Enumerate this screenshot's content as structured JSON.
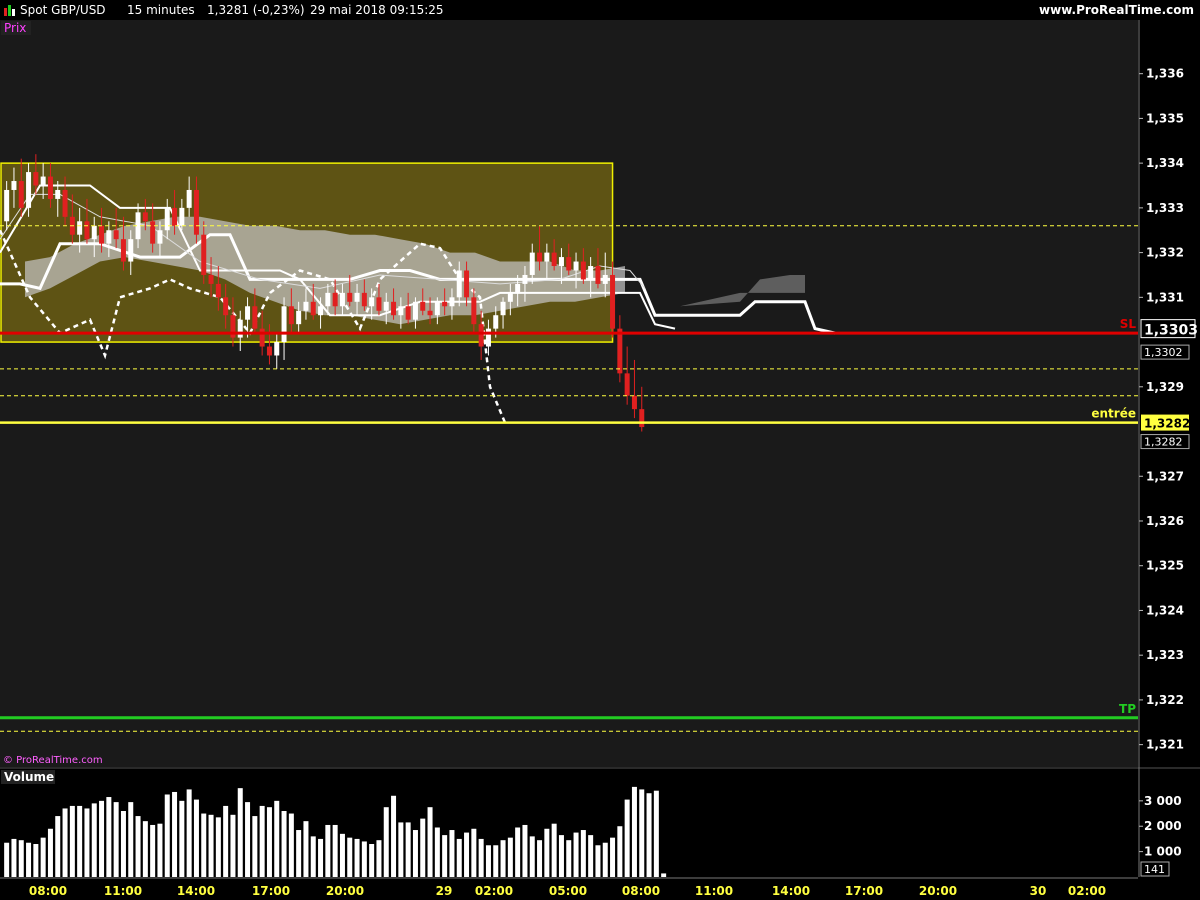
{
  "header": {
    "instrument": "Spot GBP/USD",
    "timeframe": "15 minutes",
    "last_price": "1,3281 (-0,23%)",
    "datetime": "29 mai 2018 09:15:25",
    "website": "www.ProRealTime.com"
  },
  "panels": {
    "price_label": "Prix",
    "volume_label": "Volume",
    "copyright": "© ProRealTime.com"
  },
  "colors": {
    "background": "#000000",
    "panel_bg": "#1a1a1a",
    "grid": "#404040",
    "up_candle": "#ffffff",
    "down_candle": "#e02020",
    "sl_line": "#e00000",
    "tp_line": "#22cc22",
    "entry_line": "#ffff40",
    "zone_fill": "#6b5e14",
    "zone_border": "#f0f000",
    "cloud": "#c8c8c8",
    "axis_text": "#ffffff"
  },
  "chart_data": {
    "type": "candlestick",
    "price_axis": {
      "ylim": [
        1.3205,
        1.3372
      ],
      "ticks": [
        "1,336",
        "1,335",
        "1,334",
        "1,333",
        "1,332",
        "1,331",
        "1,329",
        "1,327",
        "1,326",
        "1,325",
        "1,324",
        "1,323",
        "1,322",
        "1,321"
      ]
    },
    "time_axis": {
      "ticks": [
        "08:00",
        "11:00",
        "14:00",
        "17:00",
        "20:00",
        "29",
        "02:00",
        "05:00",
        "08:00",
        "11:00",
        "14:00",
        "17:00",
        "20:00",
        "30",
        "02:00"
      ]
    },
    "levels": [
      {
        "name": "SL",
        "value": 1.3302,
        "color": "#e00000",
        "label": "SL",
        "tag": "1,3302"
      },
      {
        "name": "entrée",
        "value": 1.3282,
        "color": "#ffff40",
        "label": "entrée",
        "tag": "1,3282"
      },
      {
        "name": "TP",
        "value": 1.3216,
        "color": "#22cc22",
        "label": "TP"
      }
    ],
    "price_tags": [
      {
        "text": "1,3303",
        "value": 1.3303,
        "style": "current"
      },
      {
        "text": "1,3282",
        "value": 1.3282,
        "style": "yellow"
      }
    ],
    "dashed_levels": [
      1.3326,
      1.3294,
      1.3288,
      1.3213
    ],
    "zone": {
      "start_bar": 0,
      "end_bar": 83,
      "top": 1.334,
      "bottom": 1.33
    },
    "candles": [
      [
        1.3327,
        1.3336,
        1.3325,
        1.3334
      ],
      [
        1.3334,
        1.3339,
        1.333,
        1.3336
      ],
      [
        1.3336,
        1.3341,
        1.3328,
        1.333
      ],
      [
        1.333,
        1.334,
        1.3328,
        1.3338
      ],
      [
        1.3338,
        1.3342,
        1.3333,
        1.3335
      ],
      [
        1.3335,
        1.334,
        1.3332,
        1.3337
      ],
      [
        1.3337,
        1.334,
        1.333,
        1.3332
      ],
      [
        1.3332,
        1.3336,
        1.3328,
        1.3334
      ],
      [
        1.3334,
        1.3337,
        1.3326,
        1.3328
      ],
      [
        1.3328,
        1.3333,
        1.3322,
        1.3324
      ],
      [
        1.3324,
        1.333,
        1.332,
        1.3327
      ],
      [
        1.3327,
        1.3332,
        1.3322,
        1.3323
      ],
      [
        1.3323,
        1.3328,
        1.3319,
        1.3326
      ],
      [
        1.3326,
        1.333,
        1.332,
        1.3322
      ],
      [
        1.3322,
        1.3327,
        1.3319,
        1.3325
      ],
      [
        1.3325,
        1.333,
        1.3321,
        1.3323
      ],
      [
        1.3323,
        1.3328,
        1.3316,
        1.3318
      ],
      [
        1.3318,
        1.3325,
        1.3315,
        1.3323
      ],
      [
        1.3323,
        1.3331,
        1.3321,
        1.3329
      ],
      [
        1.3329,
        1.3332,
        1.3325,
        1.3327
      ],
      [
        1.3327,
        1.3331,
        1.332,
        1.3322
      ],
      [
        1.3322,
        1.3327,
        1.3319,
        1.3325
      ],
      [
        1.3325,
        1.3332,
        1.3323,
        1.333
      ],
      [
        1.333,
        1.3334,
        1.3324,
        1.3326
      ],
      [
        1.3326,
        1.3332,
        1.3325,
        1.333
      ],
      [
        1.333,
        1.3337,
        1.3328,
        1.3334
      ],
      [
        1.3334,
        1.3337,
        1.3322,
        1.3324
      ],
      [
        1.3324,
        1.3327,
        1.3313,
        1.3315
      ],
      [
        1.3315,
        1.3319,
        1.331,
        1.3313
      ],
      [
        1.3313,
        1.3317,
        1.3307,
        1.331
      ],
      [
        1.331,
        1.3313,
        1.3303,
        1.3306
      ],
      [
        1.3306,
        1.331,
        1.3299,
        1.3301
      ],
      [
        1.3301,
        1.3307,
        1.3298,
        1.3305
      ],
      [
        1.3305,
        1.331,
        1.3301,
        1.3308
      ],
      [
        1.3308,
        1.3312,
        1.3302,
        1.3303
      ],
      [
        1.3303,
        1.3307,
        1.3297,
        1.3299
      ],
      [
        1.3299,
        1.3304,
        1.3295,
        1.3297
      ],
      [
        1.3297,
        1.3302,
        1.3294,
        1.33
      ],
      [
        1.33,
        1.331,
        1.3296,
        1.3308
      ],
      [
        1.3308,
        1.3312,
        1.3302,
        1.3304
      ],
      [
        1.3304,
        1.3309,
        1.3302,
        1.3307
      ],
      [
        1.3307,
        1.3312,
        1.3305,
        1.3309
      ],
      [
        1.3309,
        1.3313,
        1.3305,
        1.3306
      ],
      [
        1.3306,
        1.331,
        1.3303,
        1.3308
      ],
      [
        1.3308,
        1.3313,
        1.3306,
        1.3311
      ],
      [
        1.3311,
        1.3314,
        1.3306,
        1.3308
      ],
      [
        1.3308,
        1.3313,
        1.3306,
        1.3311
      ],
      [
        1.3311,
        1.3315,
        1.3308,
        1.3309
      ],
      [
        1.3309,
        1.3313,
        1.3306,
        1.3311
      ],
      [
        1.3311,
        1.3314,
        1.3307,
        1.3308
      ],
      [
        1.3308,
        1.3312,
        1.3305,
        1.331
      ],
      [
        1.331,
        1.3313,
        1.3306,
        1.3307
      ],
      [
        1.3307,
        1.3311,
        1.3304,
        1.3309
      ],
      [
        1.3309,
        1.3312,
        1.3305,
        1.3306
      ],
      [
        1.3306,
        1.331,
        1.3303,
        1.3308
      ],
      [
        1.3308,
        1.3311,
        1.3304,
        1.3305
      ],
      [
        1.3305,
        1.331,
        1.3303,
        1.3309
      ],
      [
        1.3309,
        1.3312,
        1.3306,
        1.3307
      ],
      [
        1.3307,
        1.331,
        1.3304,
        1.3306
      ],
      [
        1.3306,
        1.331,
        1.3304,
        1.3309
      ],
      [
        1.3309,
        1.3312,
        1.3306,
        1.3308
      ],
      [
        1.3308,
        1.3312,
        1.3305,
        1.331
      ],
      [
        1.331,
        1.3318,
        1.3308,
        1.3316
      ],
      [
        1.3316,
        1.3318,
        1.3308,
        1.331
      ],
      [
        1.331,
        1.3312,
        1.3302,
        1.3304
      ],
      [
        1.3304,
        1.3307,
        1.3296,
        1.3299
      ],
      [
        1.3299,
        1.3305,
        1.3297,
        1.3303
      ],
      [
        1.3303,
        1.3308,
        1.3301,
        1.3306
      ],
      [
        1.3306,
        1.331,
        1.3303,
        1.3309
      ],
      [
        1.3309,
        1.3313,
        1.3306,
        1.3311
      ],
      [
        1.3311,
        1.3315,
        1.3308,
        1.3313
      ],
      [
        1.3313,
        1.3317,
        1.3309,
        1.3315
      ],
      [
        1.3315,
        1.3322,
        1.3313,
        1.332
      ],
      [
        1.332,
        1.3326,
        1.3316,
        1.3318
      ],
      [
        1.3318,
        1.3322,
        1.3314,
        1.332
      ],
      [
        1.332,
        1.3323,
        1.3316,
        1.3317
      ],
      [
        1.3317,
        1.3321,
        1.3313,
        1.3319
      ],
      [
        1.3319,
        1.3322,
        1.3315,
        1.3316
      ],
      [
        1.3316,
        1.332,
        1.3312,
        1.3318
      ],
      [
        1.3318,
        1.3321,
        1.3313,
        1.3314
      ],
      [
        1.3314,
        1.3319,
        1.331,
        1.3317
      ],
      [
        1.3317,
        1.3321,
        1.3312,
        1.3313
      ],
      [
        1.3313,
        1.332,
        1.331,
        1.3315
      ],
      [
        1.3315,
        1.3318,
        1.3301,
        1.3303
      ],
      [
        1.3303,
        1.3306,
        1.3291,
        1.3293
      ],
      [
        1.3293,
        1.3299,
        1.3286,
        1.3288
      ],
      [
        1.3288,
        1.3296,
        1.3283,
        1.3285
      ],
      [
        1.3285,
        1.329,
        1.328,
        1.3281
      ]
    ],
    "volume": {
      "ticks": [
        "3 000",
        "2 000",
        "1 000"
      ],
      "last_tag": "141",
      "values": [
        1350,
        1500,
        1450,
        1350,
        1300,
        1550,
        1900,
        2400,
        2700,
        2800,
        2800,
        2700,
        2900,
        3000,
        3150,
        2950,
        2600,
        2950,
        2400,
        2200,
        2050,
        2100,
        3250,
        3350,
        3000,
        3450,
        3050,
        2500,
        2450,
        2350,
        2800,
        2450,
        3500,
        2950,
        2400,
        2800,
        2750,
        3000,
        2600,
        2500,
        1850,
        2200,
        1600,
        1500,
        2050,
        2050,
        1700,
        1550,
        1500,
        1400,
        1300,
        1450,
        2750,
        3200,
        2150,
        2150,
        1850,
        2300,
        2750,
        1950,
        1650,
        1850,
        1500,
        1750,
        1900,
        1500,
        1250,
        1250,
        1450,
        1550,
        1950,
        2050,
        1600,
        1450,
        1900,
        2100,
        1650,
        1450,
        1750,
        1850,
        1650,
        1250,
        1350,
        1550,
        2000,
        3050,
        3550,
        3450,
        3300,
        3400,
        141
      ]
    }
  }
}
